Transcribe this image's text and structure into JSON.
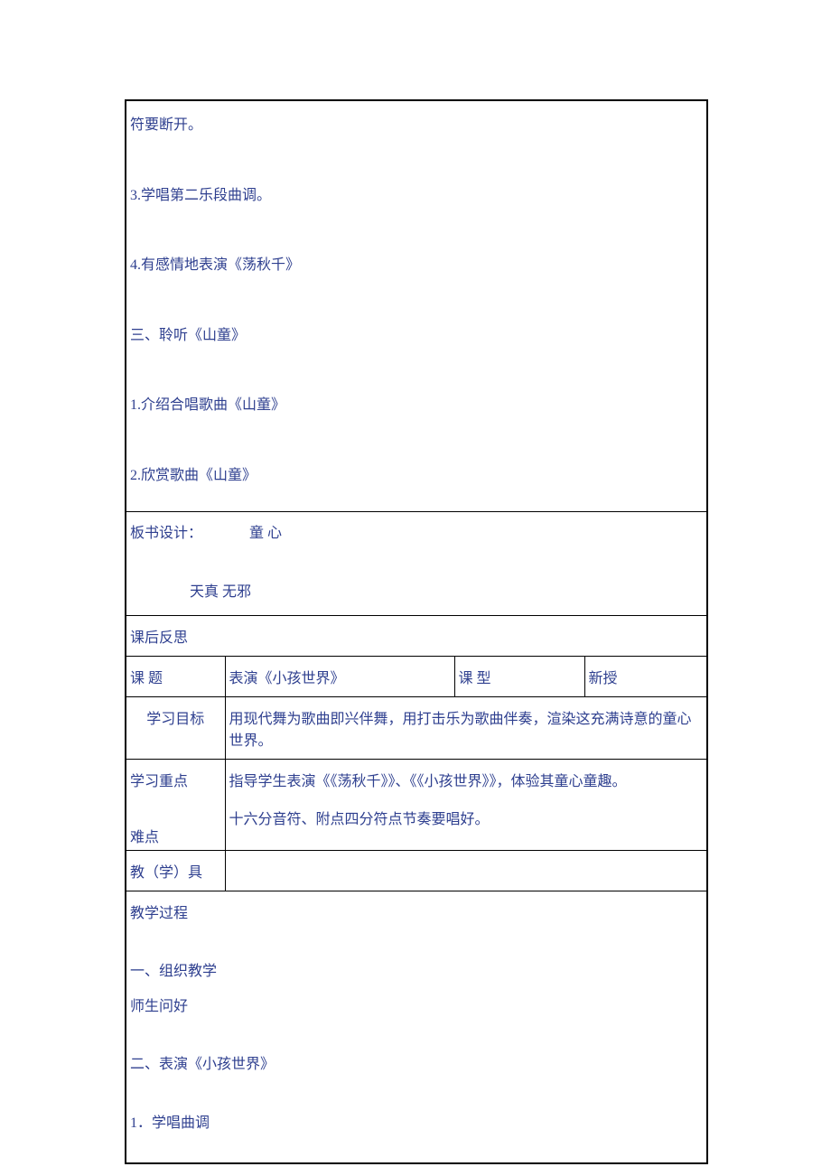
{
  "top": {
    "line1": "符要断开。",
    "line2": "3.学唱第二乐段曲调。",
    "line3": "4.有感情地表演《荡秋千》",
    "line4": "三、聆听《山童》",
    "line5": "1.介绍合唱歌曲《山童》",
    "line6": "2.欣赏歌曲《山童》"
  },
  "board": {
    "label": "板书设计：",
    "title": "童  心",
    "subtitle": "天真    无邪"
  },
  "reflection": "课后反思",
  "row_topic": {
    "label": "课    题",
    "value": "表演《小孩世界》",
    "type_label": "课    型",
    "type_value": "新授"
  },
  "row_goal": {
    "label": "学习目标",
    "value": "用现代舞为歌曲即兴伴舞，用打击乐为歌曲伴奏，渲染这充满诗意的童心世界。"
  },
  "row_focus": {
    "label1": "学习重点",
    "label2": "难点",
    "value1": "指导学生表演《《荡秋千》》、《《小孩世界》》，体验其童心童趣。",
    "value2": "十六分音符、附点四分符点节奏要唱好。"
  },
  "row_tools": {
    "label": "教（学）具"
  },
  "bottom": {
    "line1": "教学过程",
    "line2": "一、组织教学",
    "line3": "师生问好",
    "line4": "二、表演《小孩世界》",
    "line5": "1．学唱曲调"
  }
}
